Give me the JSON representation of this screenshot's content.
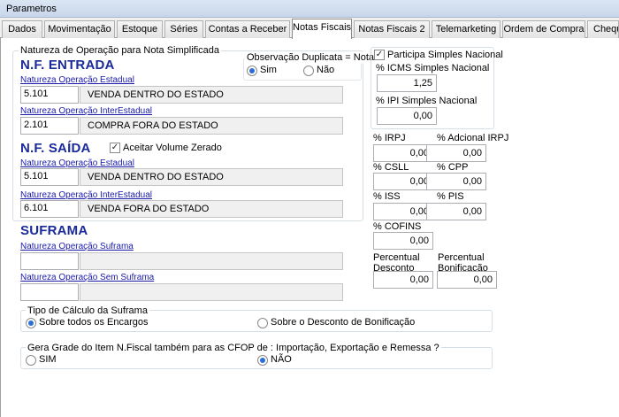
{
  "window": {
    "title": "Parametros"
  },
  "tabs": [
    "Dados",
    "Movimentação",
    "Estoque",
    "Séries",
    "Contas a Receber",
    "Notas Fiscais",
    "Notas Fiscais 2",
    "Telemarketing",
    "Ordem de Compra",
    "Cheque"
  ],
  "active_tab": "Notas Fiscais",
  "natureza": {
    "group_label": "Natureza de Operação para Nota Simplificada",
    "entrada": {
      "heading": "N.F. ENTRADA",
      "estadual_link": "Natureza Operação Estadual",
      "estadual_code": "5.101",
      "estadual_desc": "VENDA DENTRO DO ESTADO",
      "interestadual_link": "Natureza Operação InterEstadual",
      "interestadual_code": "2.101",
      "interestadual_desc": "COMPRA FORA DO ESTADO"
    },
    "saida": {
      "heading": "N.F. SAÍDA",
      "aceitar_label": "Aceitar Volume Zerado",
      "aceitar_checked": true,
      "estadual_link": "Natureza Operação Estadual",
      "estadual_code": "5.101",
      "estadual_desc": "VENDA DENTRO DO ESTADO",
      "interestadual_link": "Natureza Operação InterEstadual",
      "interestadual_code": "6.101",
      "interestadual_desc": "VENDA FORA DO ESTADO"
    }
  },
  "observacao": {
    "label": "Observação Duplicata = Nota",
    "sim": "Sim",
    "nao": "Não",
    "selected": "Sim"
  },
  "suframa": {
    "heading": "SUFRAMA",
    "link1": "Natureza Operação Suframa",
    "link2": "Natureza Operação Sem Suframa",
    "code1": "",
    "desc1": "",
    "code2": "",
    "desc2": ""
  },
  "simples": {
    "participa_label": "Participa Simples Nacional",
    "participa_checked": true,
    "icms_label": "% ICMS Simples Nacional",
    "icms_value": "1,25",
    "ipi_label": "% IPI Simples Nacional",
    "ipi_value": "0,00"
  },
  "impostos": {
    "irpj_label": "% IRPJ",
    "irpj_value": "0,00",
    "adicional_label": "% Adcional IRPJ",
    "adicional_value": "0,00",
    "csll_label": "% CSLL",
    "csll_value": "0,00",
    "cpp_label": "% CPP",
    "cpp_value": "0,00",
    "iss_label": "% ISS",
    "iss_value": "0,00",
    "pis_label": "% PIS",
    "pis_value": "0,00",
    "cofins_label": "% COFINS",
    "cofins_value": "0,00",
    "desconto_label1": "Percentual",
    "desconto_label2": "Desconto",
    "desconto_value": "0,00",
    "bonificacao_label1": "Percentual",
    "bonificacao_label2": "Bonificação",
    "bonificacao_value": "0,00"
  },
  "calculo_suframa": {
    "label": "Tipo de Cálculo da Suframa",
    "opt1": "Sobre todos os Encargos",
    "opt2": "Sobre o Desconto de Bonificação",
    "selected": "Sobre todos os Encargos"
  },
  "grade": {
    "label": "Gera Grade do Item N.Fiscal também para as CFOP de : Importação, Exportação e Remessa ?",
    "opt1": "SIM",
    "opt2": "NÃO",
    "selected": "NÃO"
  },
  "colors": {
    "accent": "#1a2a9a",
    "link": "#1a1aa8",
    "radio_fill": "#2a6fd6"
  }
}
